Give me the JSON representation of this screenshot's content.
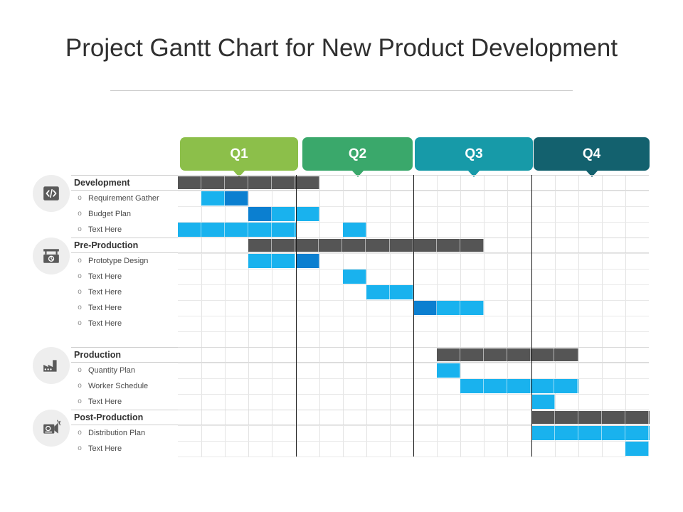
{
  "title": "Project Gantt Chart for New Product Development",
  "quarters": [
    {
      "label": "Q1",
      "color": "#8cbf4a"
    },
    {
      "label": "Q2",
      "color": "#3aa86b"
    },
    {
      "label": "Q3",
      "color": "#179aa8"
    },
    {
      "label": "Q4",
      "color": "#13616e"
    }
  ],
  "colors": {
    "summary_bar": "#555555",
    "task_bar_light": "#19b2ee",
    "task_bar_dark": "#0b7fd0",
    "grid_line": "#e3e3e3",
    "quarter_divider": "#1a1a1a",
    "title_text": "#2f2f2f"
  },
  "bullet": "o",
  "columns": 20,
  "sections": [
    {
      "name": "Development",
      "icon": "code-icon",
      "summary": {
        "start": 0,
        "span": 6,
        "type": "summary"
      },
      "tasks": [
        {
          "label": "Requirement Gather",
          "bars": [
            {
              "start": 1,
              "span": 1,
              "type": "light"
            },
            {
              "start": 2,
              "span": 1,
              "type": "dark"
            }
          ]
        },
        {
          "label": "Budget Plan",
          "bars": [
            {
              "start": 3,
              "span": 1,
              "type": "dark"
            },
            {
              "start": 4,
              "span": 1,
              "type": "light"
            },
            {
              "start": 5,
              "span": 1,
              "type": "light"
            }
          ]
        },
        {
          "label": "Text Here",
          "bars": [
            {
              "start": 0,
              "span": 5,
              "type": "light"
            },
            {
              "start": 7,
              "span": 1,
              "type": "light"
            }
          ]
        }
      ]
    },
    {
      "name": "Pre-Production",
      "icon": "press-machine-icon",
      "summary": {
        "start": 3,
        "span": 10,
        "type": "summary"
      },
      "tasks": [
        {
          "label": "Prototype Design",
          "bars": [
            {
              "start": 3,
              "span": 1,
              "type": "light"
            },
            {
              "start": 4,
              "span": 1,
              "type": "light"
            },
            {
              "start": 5,
              "span": 1,
              "type": "dark"
            }
          ]
        },
        {
          "label": "Text Here",
          "bars": [
            {
              "start": 7,
              "span": 1,
              "type": "light"
            }
          ]
        },
        {
          "label": "Text Here",
          "bars": [
            {
              "start": 8,
              "span": 2,
              "type": "light"
            }
          ]
        },
        {
          "label": "Text Here",
          "bars": [
            {
              "start": 10,
              "span": 1,
              "type": "dark"
            },
            {
              "start": 11,
              "span": 2,
              "type": "light"
            }
          ]
        },
        {
          "label": "Text Here",
          "bars": []
        }
      ]
    },
    {
      "name": "Production",
      "icon": "factory-icon",
      "summary": {
        "start": 11,
        "span": 6,
        "type": "summary"
      },
      "tasks": [
        {
          "label": "Quantity Plan",
          "bars": [
            {
              "start": 11,
              "span": 1,
              "type": "light"
            }
          ]
        },
        {
          "label": "Worker Schedule",
          "bars": [
            {
              "start": 12,
              "span": 5,
              "type": "light"
            }
          ]
        },
        {
          "label": "Text Here",
          "bars": [
            {
              "start": 15,
              "span": 1,
              "type": "light"
            }
          ]
        }
      ]
    },
    {
      "name": "Post-Production",
      "icon": "megaphone-icon",
      "summary": {
        "start": 15,
        "span": 5,
        "type": "summary"
      },
      "tasks": [
        {
          "label": "Distribution Plan",
          "bars": [
            {
              "start": 15,
              "span": 5,
              "type": "light"
            }
          ]
        },
        {
          "label": "Text Here",
          "bars": [
            {
              "start": 19,
              "span": 1,
              "type": "light"
            }
          ]
        }
      ]
    }
  ]
}
